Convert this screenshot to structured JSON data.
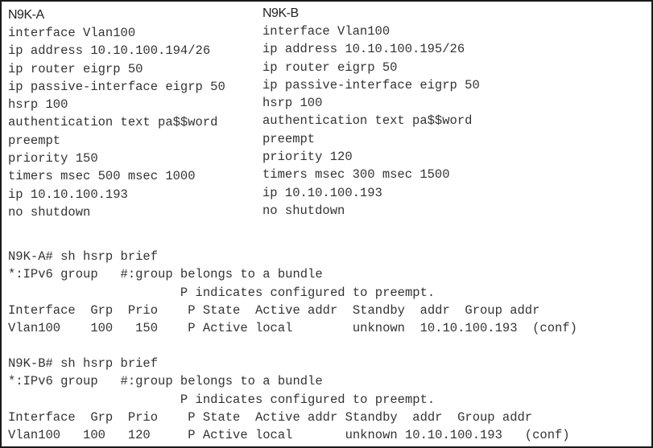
{
  "configs": [
    {
      "title": "N9K-A",
      "lines": [
        "interface Vlan100",
        "ip address 10.10.100.194/26",
        "ip router eigrp 50",
        "ip passive-interface eigrp 50",
        "hsrp 100",
        "authentication text pa$$word",
        "preempt",
        "priority 150",
        "timers msec 500 msec 1000",
        "ip 10.10.100.193",
        "no shutdown"
      ]
    },
    {
      "title": "N9K-B",
      "lines": [
        "interface Vlan100",
        "ip address 10.10.100.195/26",
        "ip router eigrp 50",
        "ip passive-interface eigrp 50",
        "hsrp 100",
        "authentication text pa$$word",
        "preempt",
        "priority 120",
        "timers msec 300 msec 1500",
        "ip 10.10.100.193",
        "no shutdown"
      ]
    }
  ],
  "outputs": [
    {
      "lines": [
        "N9K-A# sh hsrp brief",
        "*:IPv6 group   #:group belongs to a bundle",
        "                       P indicates configured to preempt.",
        "Interface  Grp  Prio    P State  Active addr  Standby  addr  Group addr",
        "Vlan100    100   150    P Active local        unknown  10.10.100.193  (conf)"
      ]
    },
    {
      "lines": [
        "N9K-B# sh hsrp brief",
        "*:IPv6 group   #:group belongs to a bundle",
        "                       P indicates configured to preempt.",
        "Interface  Grp  Prio    P State  Active addr Standby  addr  Group addr",
        "Vlan100   100   120     P Active local       unknown 10.10.100.193   (conf)"
      ]
    }
  ]
}
